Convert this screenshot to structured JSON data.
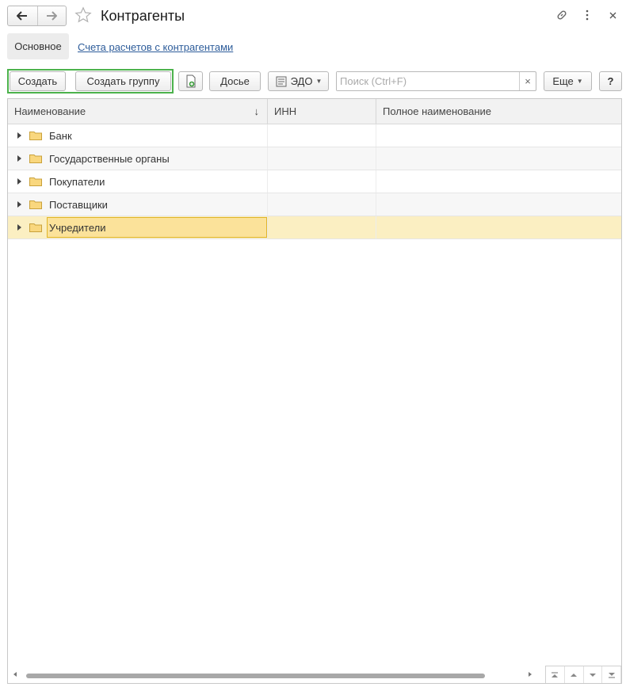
{
  "window": {
    "title": "Контрагенты",
    "icons": [
      "back-icon",
      "forward-icon",
      "favorite-star-icon",
      "link-icon",
      "more-vertical-icon",
      "close-icon"
    ]
  },
  "tabs": {
    "main": "Основное",
    "link": "Счета расчетов с контрагентами"
  },
  "toolbar": {
    "create": "Создать",
    "create_group": "Создать группу",
    "dossier": "Досье",
    "edo": "ЭДО",
    "search_placeholder": "Поиск (Ctrl+F)",
    "search_clear": "×",
    "more": "Еще",
    "help": "?",
    "highlight_color": "#4cb24c"
  },
  "table": {
    "columns": [
      "Наименование",
      "ИНН",
      "Полное наименование"
    ],
    "sort_indicator": "↓",
    "rows": [
      {
        "name": "Банк",
        "inn": "",
        "full_name": "",
        "type": "group"
      },
      {
        "name": "Государственные органы",
        "inn": "",
        "full_name": "",
        "type": "group"
      },
      {
        "name": "Покупатели",
        "inn": "",
        "full_name": "",
        "type": "group"
      },
      {
        "name": "Поставщики",
        "inn": "",
        "full_name": "",
        "type": "group"
      },
      {
        "name": "Учредители",
        "inn": "",
        "full_name": "",
        "type": "group",
        "selected": true
      }
    ],
    "selected_color": "#fbefc2",
    "focus_color": "#fbe29a"
  }
}
